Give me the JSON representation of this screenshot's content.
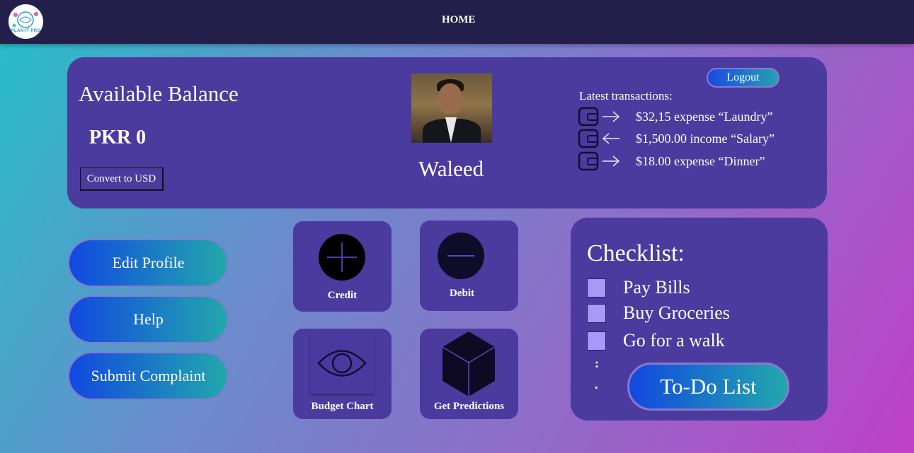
{
  "nav": {
    "logo_text": "PLAN-IT PRO",
    "home_label": "HOME",
    "logo_icon": "logo-icon"
  },
  "balance": {
    "title": "Available Balance",
    "amount": "PKR 0",
    "convert_label": "Convert to USD"
  },
  "profile": {
    "name": "Waleed",
    "avatar_icon": "user-avatar-photo"
  },
  "logout_label": "Logout",
  "transactions": {
    "title": "Latest transactions:",
    "items": [
      {
        "text": "$32,15 expense “Laundry”",
        "direction": "out"
      },
      {
        "text": "$1,500.00 income “Salary”",
        "direction": "in"
      },
      {
        "text": "$18.00 expense “Dinner”",
        "direction": "out"
      }
    ]
  },
  "actions": {
    "edit_profile": "Edit Profile",
    "help": "Help",
    "submit_complaint": "Submit Complaint"
  },
  "tiles": {
    "credit": "Credit",
    "debit": "Debit",
    "budget_chart": "Budget Chart",
    "get_predictions": "Get Predictions"
  },
  "checklist": {
    "title": "Checklist:",
    "items": [
      "Pay Bills",
      "Buy Groceries",
      "Go for a walk"
    ],
    "dot1": ":",
    "dot2": ".",
    "todo_label": "To-Do List"
  },
  "colors": {
    "topbar": "#241e4a",
    "card": "#4b3b9e",
    "checkbox": "#a898f8",
    "button_gradient_start": "#1248e0",
    "button_gradient_end": "#22a8ac"
  }
}
